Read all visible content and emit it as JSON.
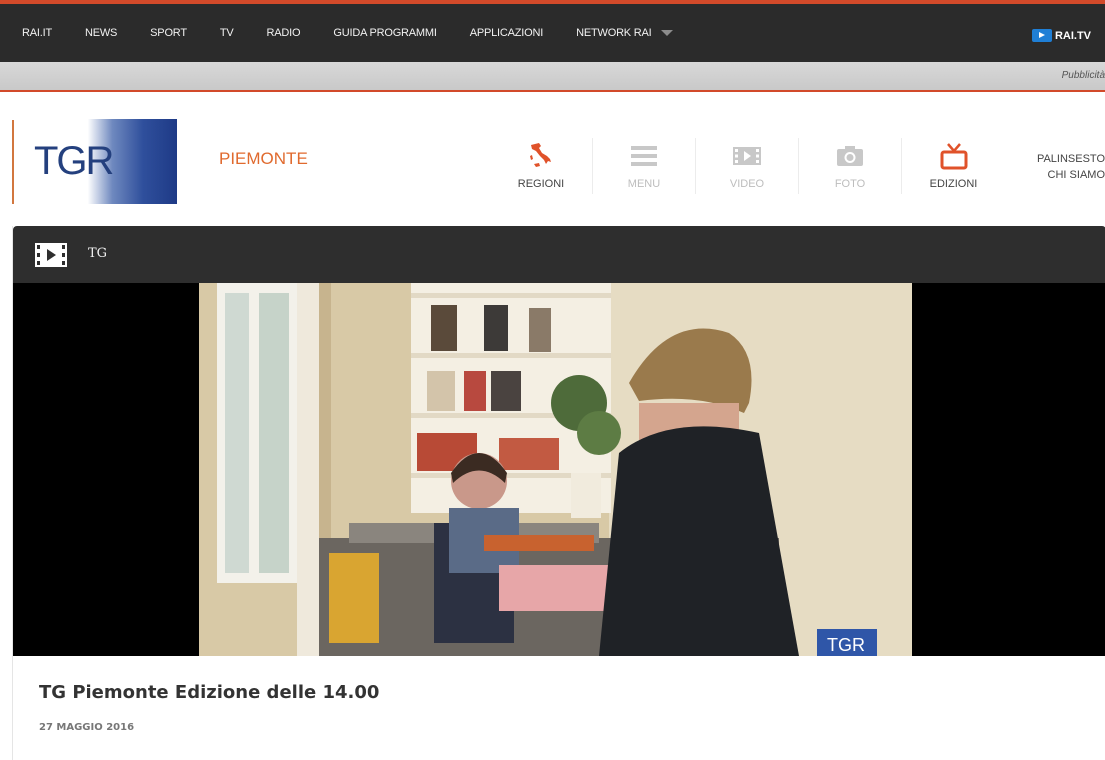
{
  "topnav": {
    "items": [
      "RAI.IT",
      "NEWS",
      "SPORT",
      "TV",
      "RADIO",
      "GUIDA PROGRAMMI",
      "APPLICAZIONI"
    ],
    "network_label": "NETWORK RAI",
    "raitv_label": "RAI.TV",
    "accent_color": "#d24a2a"
  },
  "adbar": {
    "label": "Pubblicità"
  },
  "header": {
    "logo_text": "TGR",
    "region": "PIEMONTE",
    "nav": [
      {
        "label": "REGIONI",
        "icon": "italy-map-icon",
        "active": true
      },
      {
        "label": "MENU",
        "icon": "menu-icon",
        "active": false
      },
      {
        "label": "VIDEO",
        "icon": "video-icon",
        "active": false
      },
      {
        "label": "FOTO",
        "icon": "camera-icon",
        "active": false
      },
      {
        "label": "EDIZIONI",
        "icon": "tv-icon",
        "active": true
      }
    ],
    "links": [
      "PALINSESTO",
      "CHI SIAMO"
    ],
    "region_color": "#e06a2e"
  },
  "video_card": {
    "bar_label": "TG",
    "title": "TG Piemonte Edizione delle 14.00",
    "date": "27 MAGGIO 2016",
    "watermark": "TGR"
  }
}
